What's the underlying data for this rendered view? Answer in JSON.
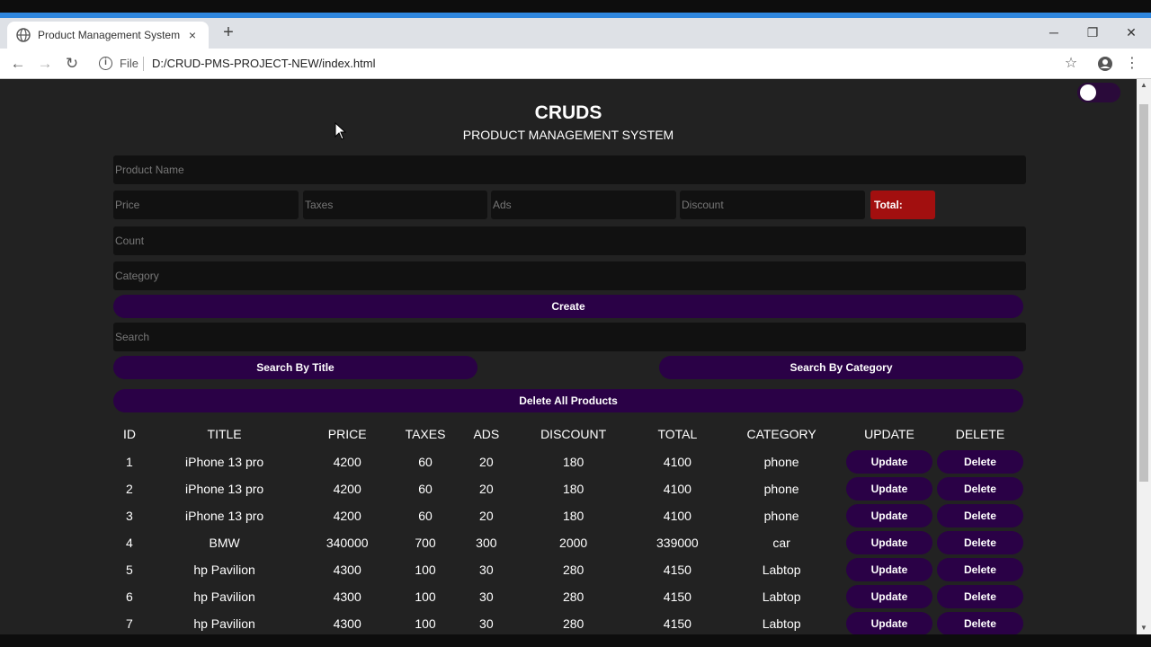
{
  "browser": {
    "tab_title": "Product Management System",
    "tab_close": "×",
    "new_tab": "+",
    "file_label": "File",
    "url": "D:/CRUD-PMS-PROJECT-NEW/index.html",
    "window_minimize": "─",
    "window_restore": "❐",
    "window_close": "✕"
  },
  "app": {
    "title": "CRUDS",
    "subtitle": "PRODUCT MANAGEMENT SYSTEM",
    "inputs": {
      "product_name": "Product Name",
      "price": "Price",
      "taxes": "Taxes",
      "ads": "Ads",
      "discount": "Discount",
      "count": "Count",
      "category": "Category",
      "search": "Search"
    },
    "total_label": "Total:",
    "create_label": "Create",
    "search_title_label": "Search By Title",
    "search_category_label": "Search By Category",
    "delete_all_label": "Delete All Products",
    "table": {
      "headers": [
        "ID",
        "TITLE",
        "PRICE",
        "TAXES",
        "ADS",
        "DISCOUNT",
        "TOTAL",
        "CATEGORY",
        "UPDATE",
        "DELETE"
      ],
      "update_label": "Update",
      "delete_label": "Delete",
      "rows": [
        [
          "1",
          "iPhone 13 pro",
          "4200",
          "60",
          "20",
          "180",
          "4100",
          "phone"
        ],
        [
          "2",
          "iPhone 13 pro",
          "4200",
          "60",
          "20",
          "180",
          "4100",
          "phone"
        ],
        [
          "3",
          "iPhone 13 pro",
          "4200",
          "60",
          "20",
          "180",
          "4100",
          "phone"
        ],
        [
          "4",
          "BMW",
          "340000",
          "700",
          "300",
          "2000",
          "339000",
          "car"
        ],
        [
          "5",
          "hp Pavilion",
          "4300",
          "100",
          "30",
          "280",
          "4150",
          "Labtop"
        ],
        [
          "6",
          "hp Pavilion",
          "4300",
          "100",
          "30",
          "280",
          "4150",
          "Labtop"
        ],
        [
          "7",
          "hp Pavilion",
          "4300",
          "100",
          "30",
          "280",
          "4150",
          "Labtop"
        ]
      ]
    }
  },
  "colors": {
    "background": "#222222",
    "input_bg": "#111111",
    "button_purple": "#2a0146",
    "total_red": "#a20f0f"
  }
}
